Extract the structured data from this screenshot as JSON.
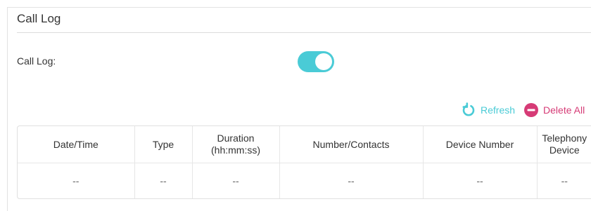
{
  "section": {
    "title": "Call Log"
  },
  "setting": {
    "label": "Call Log:",
    "enabled": true
  },
  "toolbar": {
    "refresh_label": "Refresh",
    "delete_all_label": "Delete All"
  },
  "colors": {
    "accent": "#4acbd6",
    "danger": "#d63b76"
  },
  "table": {
    "columns": [
      {
        "line1": "Date/Time",
        "line2": ""
      },
      {
        "line1": "Type",
        "line2": ""
      },
      {
        "line1": "Duration",
        "line2": "(hh:mm:ss)"
      },
      {
        "line1": "Number/Contacts",
        "line2": ""
      },
      {
        "line1": "Device Number",
        "line2": ""
      },
      {
        "line1": "Telephony",
        "line2": "Device"
      }
    ],
    "rows": [
      [
        "--",
        "--",
        "--",
        "--",
        "--",
        "--"
      ]
    ]
  }
}
